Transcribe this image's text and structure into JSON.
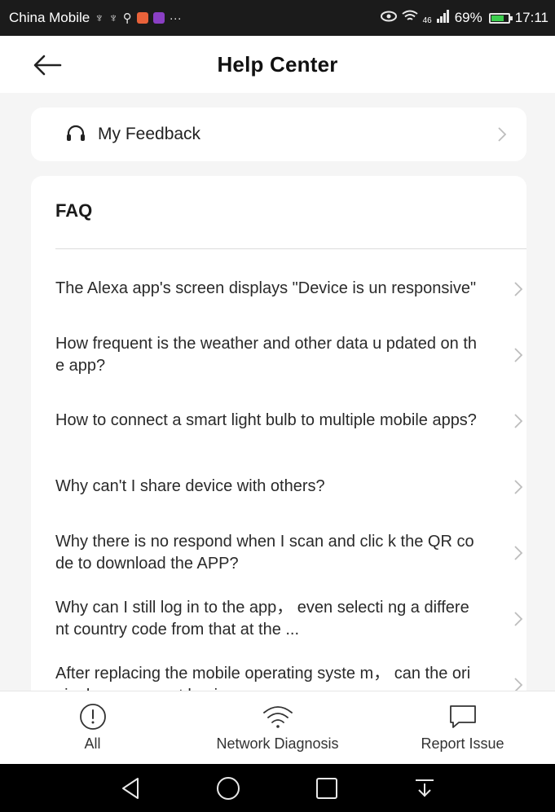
{
  "status_bar": {
    "carrier": "China Mobile",
    "signal_label": "46",
    "battery": "69%",
    "battery_level": 0.69,
    "time": "17:11"
  },
  "header": {
    "title": "Help Center"
  },
  "feedback": {
    "label": "My Feedback"
  },
  "faq": {
    "title": "FAQ",
    "items": [
      {
        "text": "The Alexa app's screen displays \"Device is un responsive\""
      },
      {
        "text": "How frequent is the weather and other data u pdated on the app?"
      },
      {
        "text": "How to connect a smart light bulb to multiple mobile apps?"
      },
      {
        "text": "Why can't I share device with others?"
      },
      {
        "text": "Why there is no respond when I scan and clic k the QR code to download the APP?"
      },
      {
        "text": "Why can I still log in to the app， even selecti ng a different country code from that at the ..."
      },
      {
        "text": "After replacing the mobile operating syste m， can the original app account log in nor ..."
      }
    ]
  },
  "actions": {
    "all": "All",
    "network": "Network Diagnosis",
    "report": "Report Issue"
  },
  "colors": {
    "status_bar_bg": "#1b1b1b",
    "page_bg": "#f5f5f5",
    "card_bg": "#ffffff",
    "battery_green": "#3ccf4e",
    "nav_bar_bg": "#000000"
  },
  "icons": {
    "back": "arrow-left-icon",
    "feedback": "headset-icon",
    "chevron": "chevron-right-icon",
    "all": "exclamation-circle-icon",
    "network": "wifi-icon",
    "report": "chat-bubble-icon"
  }
}
